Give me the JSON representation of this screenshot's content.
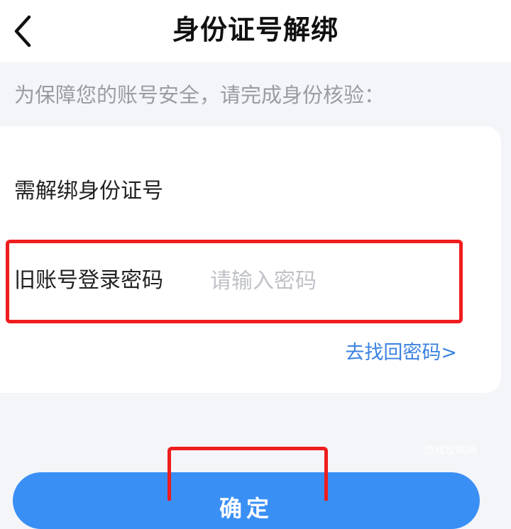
{
  "header": {
    "title": "身份证号解绑",
    "back_icon": "chevron-left-icon"
  },
  "notice": {
    "text": "为保障您的账号安全，请完成身份核验："
  },
  "form": {
    "id_label": "需解绑身份证号",
    "password_label": "旧账号登录密码",
    "password_placeholder": "请输入密码",
    "password_value": "",
    "recover_link": "去找回密码>"
  },
  "confirm": {
    "label": "确定"
  },
  "watermark": "游戏攻略网",
  "colors": {
    "accent": "#3a8ff5",
    "link": "#3b82e0",
    "highlight": "#ef1d1d",
    "background": "#f4f5f9"
  }
}
